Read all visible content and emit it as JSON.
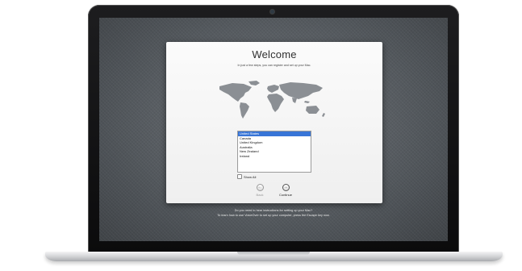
{
  "setup": {
    "title": "Welcome",
    "subtitle": "In just a few steps, you can register and set up your Mac.",
    "countries": [
      "United States",
      "Canada",
      "United Kingdom",
      "Australia",
      "New Zealand",
      "Ireland"
    ],
    "selected_country": "United States",
    "show_all_label": "Show All",
    "show_all_checked": false,
    "back_label": "Back",
    "continue_label": "Continue"
  },
  "voiceover": {
    "line1": "Do you need to hear instructions for setting up your Mac?",
    "line2": "To learn how to use VoiceOver to set up your computer, press the Escape key now."
  },
  "colors": {
    "selection": "#3875d7",
    "bezel": "#111111",
    "screen": "#5b6065",
    "map": "#8b8f94",
    "body": "#d6d7d9"
  },
  "icons": {
    "back": "arrow-left-circle-icon",
    "continue": "arrow-right-circle-icon",
    "camera": "camera-icon"
  }
}
